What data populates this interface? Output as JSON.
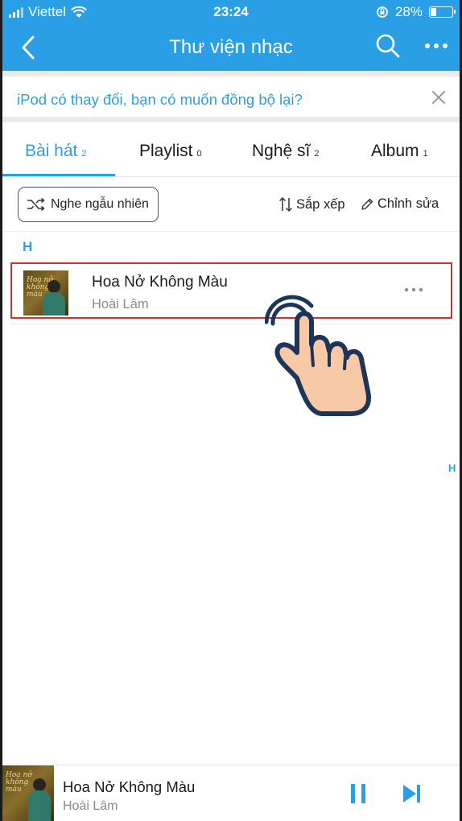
{
  "status_bar": {
    "carrier": "Viettel",
    "time": "23:24",
    "battery": "28%",
    "battery_level": 0.28
  },
  "nav": {
    "title": "Thư viện nhạc",
    "back_icon": "chevron-left-icon",
    "search_icon": "search-icon",
    "more_icon": "more-horizontal-icon"
  },
  "banner": {
    "text": "iPod có thay đổi, bạn có muốn đồng bộ lại?",
    "close_icon": "close-icon"
  },
  "tabs": [
    {
      "label": "Bài hát",
      "count": "2",
      "active": true
    },
    {
      "label": "Playlist",
      "count": "0",
      "active": false
    },
    {
      "label": "Nghệ sĩ",
      "count": "2",
      "active": false
    },
    {
      "label": "Album",
      "count": "1",
      "active": false
    }
  ],
  "toolbar": {
    "shuffle_label": "Nghe ngẫu nhiên",
    "sort_label": "Sắp xếp",
    "edit_label": "Chỉnh sửa"
  },
  "section": {
    "letter": "H"
  },
  "songs": [
    {
      "title": "Hoa Nở Không Màu",
      "artist": "Hoài Lâm",
      "cover_text": "Hoa nở không màu"
    }
  ],
  "index_bar": {
    "letter": "H"
  },
  "player": {
    "title": "Hoa Nở Không Màu",
    "artist": "Hoài Lâm",
    "pause_icon": "pause-icon",
    "next_icon": "skip-next-icon"
  },
  "colors": {
    "accent": "#2b9fe6",
    "highlight_border": "#d32f2f"
  }
}
